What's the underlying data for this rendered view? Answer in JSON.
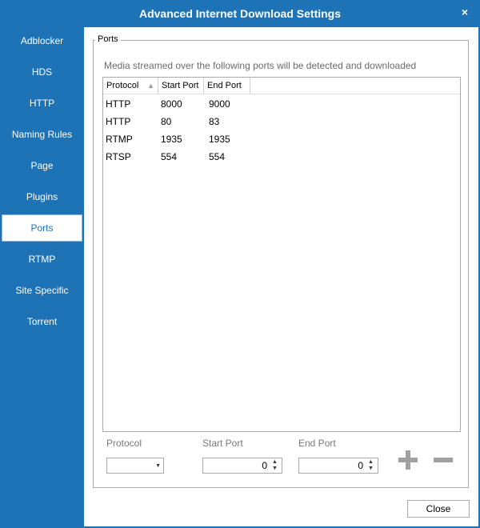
{
  "window": {
    "title": "Advanced Internet Download Settings",
    "close_glyph": "×"
  },
  "sidebar": {
    "items": [
      {
        "label": "Adblocker"
      },
      {
        "label": "HDS"
      },
      {
        "label": "HTTP"
      },
      {
        "label": "Naming Rules"
      },
      {
        "label": "Page"
      },
      {
        "label": "Plugins"
      },
      {
        "label": "Ports"
      },
      {
        "label": "RTMP"
      },
      {
        "label": "Site Specific"
      },
      {
        "label": "Torrent"
      }
    ],
    "active": "Ports"
  },
  "ports_group": {
    "title": "Ports",
    "hint": "Media streamed over the following ports will be detected and downloaded",
    "table": {
      "columns": [
        "Protocol",
        "Start Port",
        "End Port"
      ],
      "sort_icon": "sort-ascending-icon",
      "rows": [
        {
          "protocol": "HTTP",
          "start": "8000",
          "end": "9000"
        },
        {
          "protocol": "HTTP",
          "start": "80",
          "end": "83"
        },
        {
          "protocol": "RTMP",
          "start": "1935",
          "end": "1935"
        },
        {
          "protocol": "RTSP",
          "start": "554",
          "end": "554"
        }
      ]
    },
    "form": {
      "protocol_label": "Protocol",
      "protocol_value": "",
      "start_label": "Start Port",
      "start_value": "0",
      "end_label": "End Port",
      "end_value": "0"
    }
  },
  "buttons": {
    "close_label": "Close"
  },
  "colors": {
    "accent": "#1e73b7"
  }
}
